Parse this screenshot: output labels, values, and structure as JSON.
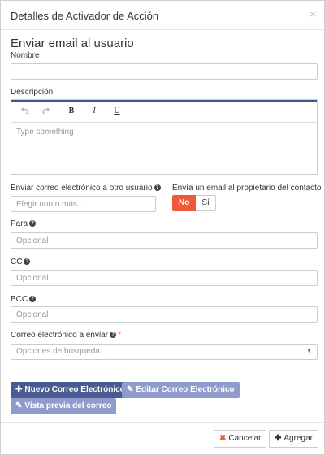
{
  "modal": {
    "title": "Detalles de Activador de Acción",
    "close": "×"
  },
  "section_title": "Enviar email al usuario",
  "fields": {
    "nombre": {
      "label": "Nombre",
      "value": ""
    },
    "descripcion": {
      "label": "Descripción",
      "placeholder": "Type something"
    },
    "otro_usuario": {
      "label": "Enviar correo electrónico a otro usuario",
      "placeholder": "Elegir uno o más..."
    },
    "propietario": {
      "label": "Envía un email al propietario del contacto",
      "options": [
        "No",
        "Sí"
      ],
      "selected": "No"
    },
    "para": {
      "label": "Para",
      "placeholder": "Opcional"
    },
    "cc": {
      "label": "CC",
      "placeholder": "Opcional"
    },
    "bcc": {
      "label": "BCC",
      "placeholder": "Opcional"
    },
    "correo": {
      "label": "Correo electrónico a enviar",
      "required": "*",
      "placeholder": "Opciones de búsqueda..."
    }
  },
  "toolbar": {
    "undo": "undo-icon",
    "redo": "redo-icon",
    "bold": "B",
    "italic": "I",
    "underline": "U"
  },
  "buttons": {
    "nuevo": "Nuevo Correo Electrónico",
    "editar": "Editar Correo Electrónico",
    "vista": "Vista previa del correo",
    "cancelar": "Cancelar",
    "agregar": "Agregar"
  },
  "colors": {
    "primary": "#4a5b92",
    "primary_light": "#8d9ccc",
    "toggle_active": "#ef5a3a",
    "editor_accent": "#3a5b8c"
  }
}
